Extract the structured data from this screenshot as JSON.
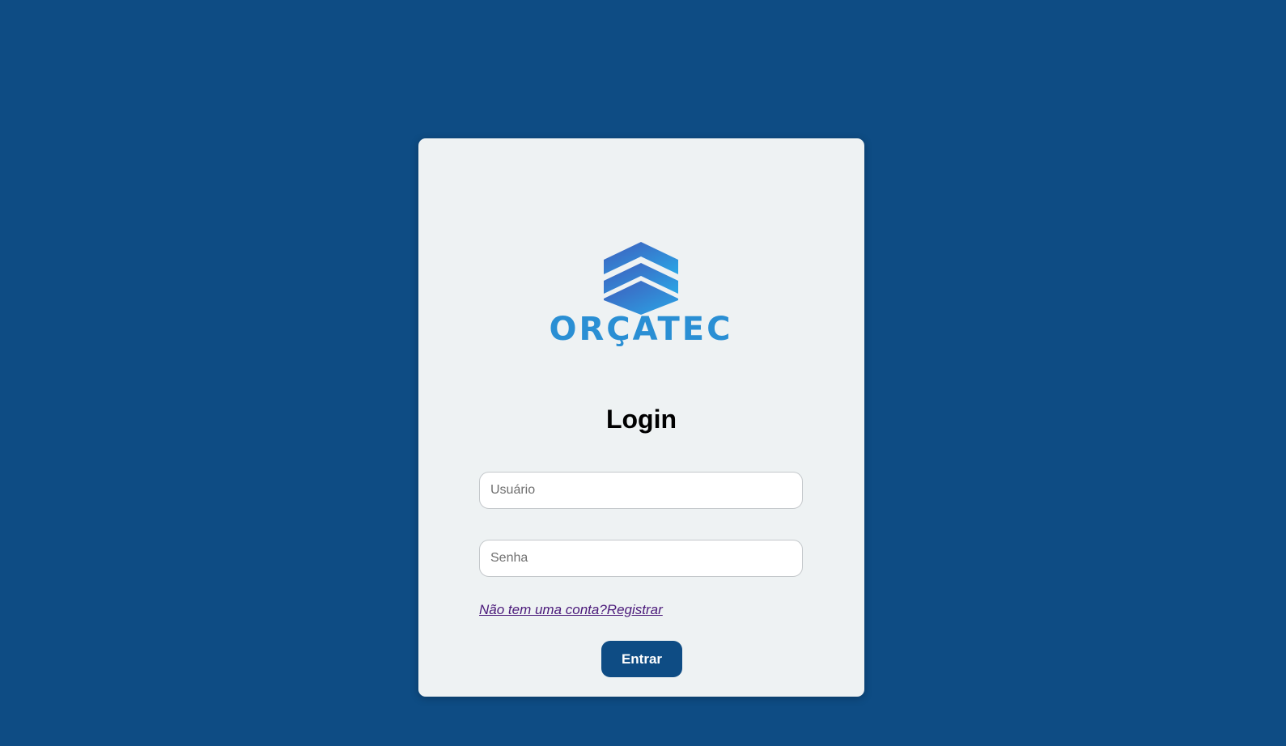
{
  "brand": {
    "name": "ORÇATEC",
    "colors": {
      "logo_dark": "#3f5cbc",
      "logo_light": "#2aa6e6",
      "wordmark": "#2a8fd4"
    }
  },
  "login": {
    "title": "Login",
    "username_placeholder": "Usuário",
    "password_placeholder": "Senha",
    "register_link": "Não tem uma conta?Registrar",
    "submit_label": "Entrar"
  },
  "theme": {
    "background": "#0e4c84",
    "card_background": "#eef2f3",
    "button_background": "#0e4c84"
  }
}
